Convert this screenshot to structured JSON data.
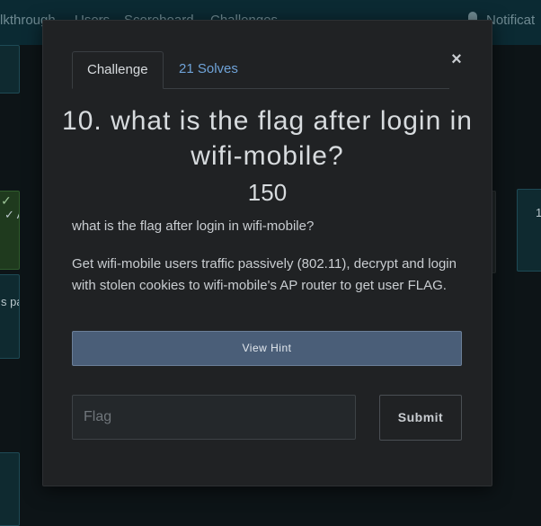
{
  "background": {
    "nav_items": [
      "lkthrough",
      "Users",
      "Scoreboard",
      "Challenges"
    ],
    "notifications_label": "Notificat",
    "cards": [
      {
        "text": ""
      },
      {
        "text": "✓ AI"
      },
      {
        "text": "s pa"
      },
      {
        "text": ""
      },
      {
        "text": "1"
      },
      {
        "text": ""
      }
    ]
  },
  "modal": {
    "close_label": "×",
    "tabs": [
      {
        "label": "Challenge",
        "active": true
      },
      {
        "label": "21 Solves",
        "active": false
      }
    ],
    "title": "10. what is the flag after login in wifi-mobile?",
    "value": "150",
    "short_description": "what is the flag after login in wifi-mobile?",
    "description": "Get wifi-mobile users traffic passively (802.11), decrypt and login with stolen cookies to wifi-mobile's AP router to get user FLAG.",
    "hint_button_label": "View Hint",
    "flag_input": {
      "placeholder": "Flag",
      "value": ""
    },
    "submit_label": "Submit"
  },
  "colors": {
    "modal_background": "#202224",
    "link": "#6fa3d8",
    "hint_button": "#4a5e78"
  }
}
